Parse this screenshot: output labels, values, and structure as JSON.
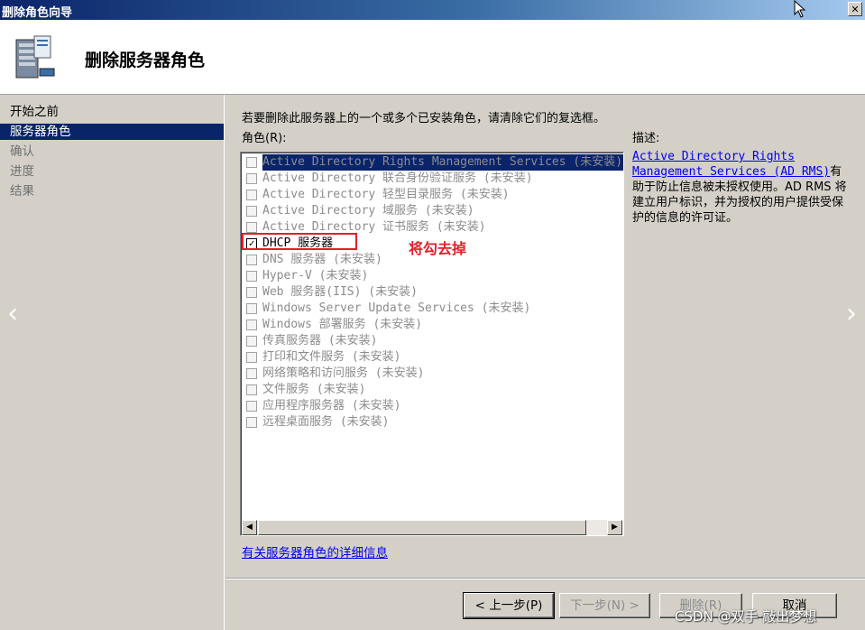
{
  "window": {
    "title": "删除角色向导",
    "close_glyph": "✕"
  },
  "header": {
    "heading": "删除服务器角色",
    "icon": "server-icon"
  },
  "nav": {
    "items": [
      {
        "label": "开始之前",
        "state": "done"
      },
      {
        "label": "服务器角色",
        "state": "active"
      },
      {
        "label": "确认",
        "state": "pending"
      },
      {
        "label": "进度",
        "state": "pending"
      },
      {
        "label": "结果",
        "state": "pending"
      }
    ],
    "left_arrow": "‹",
    "right_arrow": "›"
  },
  "main": {
    "instruction": "若要删除此服务器上的一个或多个已安装角色，请清除它们的复选框。",
    "roles_label": "角色(R):",
    "description_label": "描述:",
    "roles": [
      {
        "label": "Active Directory Rights Management Services  (未安装)",
        "checked": false,
        "selected": true,
        "disabled": true
      },
      {
        "label": "Active Directory 联合身份验证服务  (未安装)",
        "checked": false,
        "selected": false,
        "disabled": true
      },
      {
        "label": "Active Directory 轻型目录服务  (未安装)",
        "checked": false,
        "selected": false,
        "disabled": true
      },
      {
        "label": "Active Directory 域服务  (未安装)",
        "checked": false,
        "selected": false,
        "disabled": true
      },
      {
        "label": "Active Directory 证书服务  (未安装)",
        "checked": false,
        "selected": false,
        "disabled": true
      },
      {
        "label": "DHCP 服务器",
        "checked": true,
        "selected": false,
        "disabled": false
      },
      {
        "label": "DNS 服务器  (未安装)",
        "checked": false,
        "selected": false,
        "disabled": true
      },
      {
        "label": "Hyper-V  (未安装)",
        "checked": false,
        "selected": false,
        "disabled": true
      },
      {
        "label": "Web 服务器(IIS)  (未安装)",
        "checked": false,
        "selected": false,
        "disabled": true
      },
      {
        "label": "Windows Server Update Services  (未安装)",
        "checked": false,
        "selected": false,
        "disabled": true
      },
      {
        "label": "Windows 部署服务  (未安装)",
        "checked": false,
        "selected": false,
        "disabled": true
      },
      {
        "label": "传真服务器  (未安装)",
        "checked": false,
        "selected": false,
        "disabled": true
      },
      {
        "label": "打印和文件服务  (未安装)",
        "checked": false,
        "selected": false,
        "disabled": true
      },
      {
        "label": "网络策略和访问服务  (未安装)",
        "checked": false,
        "selected": false,
        "disabled": true
      },
      {
        "label": "文件服务  (未安装)",
        "checked": false,
        "selected": false,
        "disabled": true
      },
      {
        "label": "应用程序服务器  (未安装)",
        "checked": false,
        "selected": false,
        "disabled": true
      },
      {
        "label": "远程桌面服务  (未安装)",
        "checked": false,
        "selected": false,
        "disabled": true
      }
    ],
    "annotation": "将勾去掉",
    "description": {
      "link_text": "Active Directory Rights Management Services (AD RMS)",
      "body": "有助于防止信息被未授权使用。AD RMS 将建立用户标识，并为授权的用户提供受保护的信息的许可证。"
    },
    "more_info_link": "有关服务器角色的详细信息"
  },
  "buttons": {
    "back": "< 上一步(P)",
    "next": "下一步(N) >",
    "remove": "删除(R)",
    "cancel": "取消"
  },
  "watermark": "CSDN @双手·敲出梦想",
  "colors": {
    "selection": "#0a246a",
    "annotation": "#e0202a",
    "link": "#0000ee"
  }
}
